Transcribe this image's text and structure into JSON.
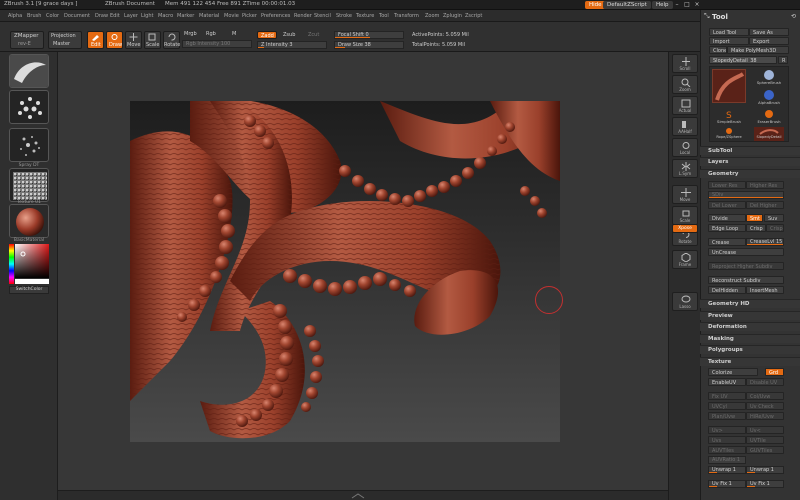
{
  "titlebar": {
    "app": "ZBrush 3.1 [9 grace days ]",
    "document": "ZBrush Document",
    "mem": "Mem 491 122 454  Free 891  ZTime 00:00:01.03",
    "hide_label": "Hide",
    "script_label": "DefaultZScript",
    "help_label": "Help"
  },
  "menubar": {
    "items": [
      "Alpha",
      "Brush",
      "Color",
      "Document",
      "Draw",
      "Edit",
      "Layer",
      "Light",
      "Macro",
      "Marker",
      "Material",
      "Movie",
      "Picker",
      "Preferences",
      "Render",
      "Stencil",
      "Stroke",
      "Texture",
      "Tool",
      "Transform",
      "Zoom",
      "Zplugin",
      "Zscript"
    ]
  },
  "shelf": {
    "zmapper": "ZMapper",
    "zmapper_sub": "rev-E",
    "projection": "Projection",
    "projection_sub": "Master",
    "edit": "Edit",
    "draw": "Draw",
    "move": "Move",
    "scale": "Scale",
    "rotate": "Rotate",
    "mrgb": "Mrgb",
    "rgb": "Rgb",
    "m": "M",
    "rgb_intensity": "Rgb Intensity 100",
    "zadd": "Zadd",
    "zsub": "Zsub",
    "zcut": "Zcut",
    "z_intensity": "Z Intensity 3",
    "focal_shift": "Focal Shift 0",
    "draw_size": "Draw Size 38",
    "active_points": "ActivePoints: 5.059 Mil",
    "total_points": "TotalPoints: 5.059 Mil"
  },
  "lefttray": {
    "labels": [
      "",
      "",
      "Spray DT",
      "Texture 01",
      "BasicMaterial",
      "SwitchColor"
    ]
  },
  "rightstrip": {
    "buttons": [
      "Scroll",
      "Zoom",
      "Actual",
      "AAHalf",
      "Local",
      "L.Sym",
      "Move",
      "Scale",
      "Rotate",
      "Xpose",
      "Frame",
      "Lasso"
    ]
  },
  "tool": {
    "title": "Tool",
    "load": "Load Tool",
    "save_as": "Save As",
    "import": "Import",
    "export": "Export",
    "clone": "Clone",
    "make_polymesh": "Make PolyMesh3D",
    "subtool_name": "SlopedyDetail_38",
    "subtool_count": "R",
    "brushes": [
      "SphereBrush",
      "AlphaBrush",
      "SimpleBrush",
      "EraserBrush",
      "Rope/ZSphere",
      "SlopedyDetail"
    ]
  },
  "sections": {
    "subtool": "SubTool",
    "layers": "Layers",
    "geometry": "Geometry",
    "geometry_hd": "Geometry HD",
    "preview": "Preview",
    "deformation": "Deformation",
    "masking": "Masking",
    "polygroups": "Polygroups",
    "texture": "Texture"
  },
  "geometry": {
    "lower_res": "Lower Res",
    "higher_res": "Higher Res",
    "sdiv": "SDiv",
    "del_lower": "Del Lower",
    "del_higher": "Del Higher",
    "divide": "Divide",
    "smt": "Smt",
    "suv": "Suv",
    "edge_loop": "Edge Loop",
    "crisp": "Crisp",
    "crisp_value": "Crisp",
    "crease": "Crease",
    "crease_lvl": "CreaseLvl 15",
    "uncrease": "UnCrease",
    "reproject": "Reproject Higher Subdiv",
    "reconstruct": "Reconstruct Subdiv",
    "delhidden": "DelHidden",
    "insert_mesh": "InsertMesh"
  },
  "texture": {
    "colorize": "Colorize",
    "grd": "Grd",
    "enable_uv": "EnableUV",
    "disable_uv": "Disable UV",
    "rows": [
      [
        "Fix UV",
        "Col/Uvw"
      ],
      [
        "UVCyl",
        "Uv Check"
      ],
      [
        "Plan/Uvw",
        "HiRe/Uvw"
      ],
      [
        "Uv>",
        "Uv<"
      ],
      [
        "Uvs",
        "UVTile"
      ],
      [
        "AUVTiles",
        "GUVTiles"
      ],
      [
        "AUVRatio 1",
        ""
      ],
      [
        "Unwrap 1",
        "Unwrap 1"
      ],
      [
        "Uv Fix 1",
        "Uv Fix 1"
      ]
    ]
  }
}
